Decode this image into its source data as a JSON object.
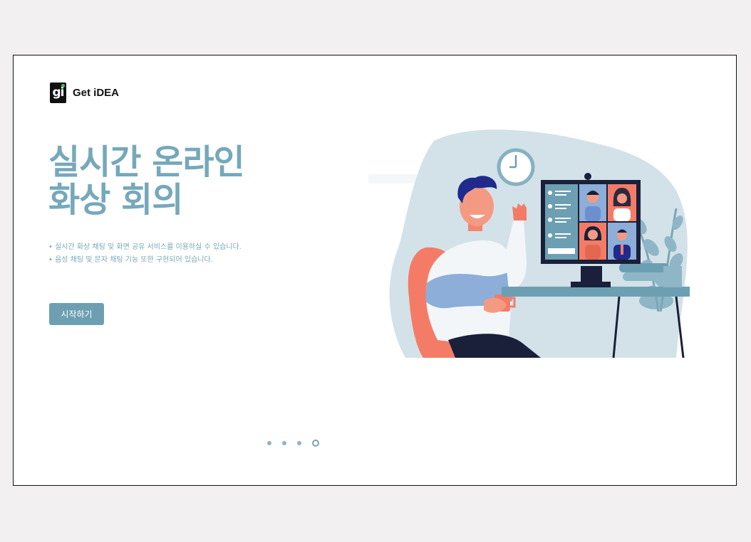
{
  "brand": {
    "logo_mark": "gi",
    "name": "Get iDEA"
  },
  "hero": {
    "title_line1": "실시간 온라인",
    "title_line2": "화상 회의",
    "bullets": [
      "• 실시간 화상 채팅 및 화면 공유 서비스를 이용하실 수 있습니다.",
      "• 음성 채팅 및 문자 채팅 기능 또한 구현되어 있습니다."
    ],
    "start_button": "시작하기"
  },
  "carousel": {
    "total": 4,
    "active_index": 3
  },
  "colors": {
    "accent": "#6d9fb3",
    "title": "#76a8bb",
    "background": "#f2f0f1"
  },
  "illustration": {
    "name": "video-conference-illustration"
  }
}
